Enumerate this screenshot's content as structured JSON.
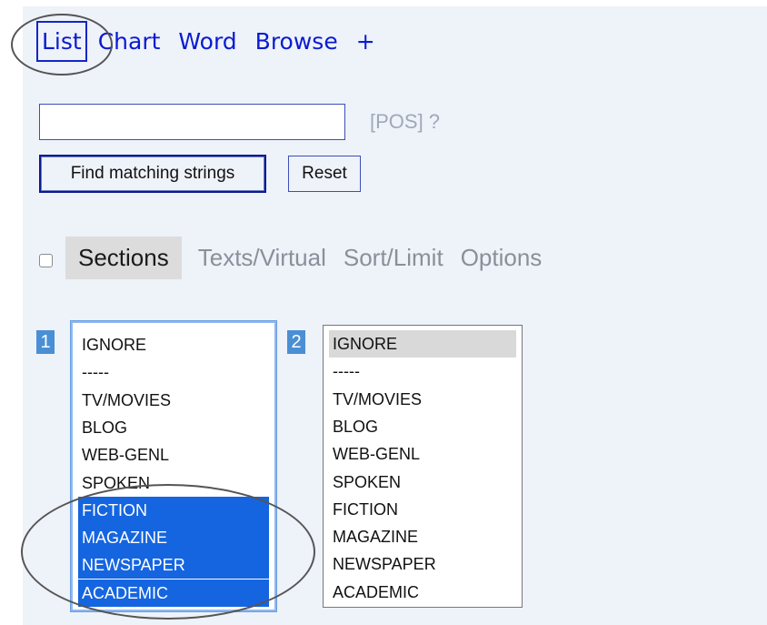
{
  "nav": {
    "items": [
      {
        "label": "List",
        "active": true
      },
      {
        "label": "Chart",
        "active": false
      },
      {
        "label": "Word",
        "active": false
      },
      {
        "label": "Browse",
        "active": false
      },
      {
        "label": "+",
        "active": false
      }
    ]
  },
  "search": {
    "value": "",
    "pos_hint": "[POS] ?"
  },
  "buttons": {
    "find_label": "Find matching strings",
    "reset_label": "Reset"
  },
  "tabs": {
    "checkbox_checked": false,
    "items": [
      {
        "label": "Sections",
        "active": true
      },
      {
        "label": "Texts/Virtual",
        "active": false
      },
      {
        "label": "Sort/Limit",
        "active": false
      },
      {
        "label": "Options",
        "active": false
      }
    ]
  },
  "sections": {
    "list1": {
      "number": "1",
      "options": [
        "IGNORE",
        "-----",
        "TV/MOVIES",
        "BLOG",
        "WEB-GENL",
        "SPOKEN",
        "FICTION",
        "MAGAZINE",
        "NEWSPAPER",
        "ACADEMIC"
      ],
      "selected": [
        "FICTION",
        "MAGAZINE",
        "NEWSPAPER",
        "ACADEMIC"
      ]
    },
    "list2": {
      "number": "2",
      "options": [
        "IGNORE",
        "-----",
        "TV/MOVIES",
        "BLOG",
        "WEB-GENL",
        "SPOKEN",
        "FICTION",
        "MAGAZINE",
        "NEWSPAPER",
        "ACADEMIC"
      ],
      "selected": [
        "IGNORE"
      ]
    }
  },
  "colors": {
    "link": "#0a1bd0",
    "panel_bg": "#eef2f9",
    "selection_blue": "#1565e0",
    "number_badge": "#4a8fd4"
  }
}
